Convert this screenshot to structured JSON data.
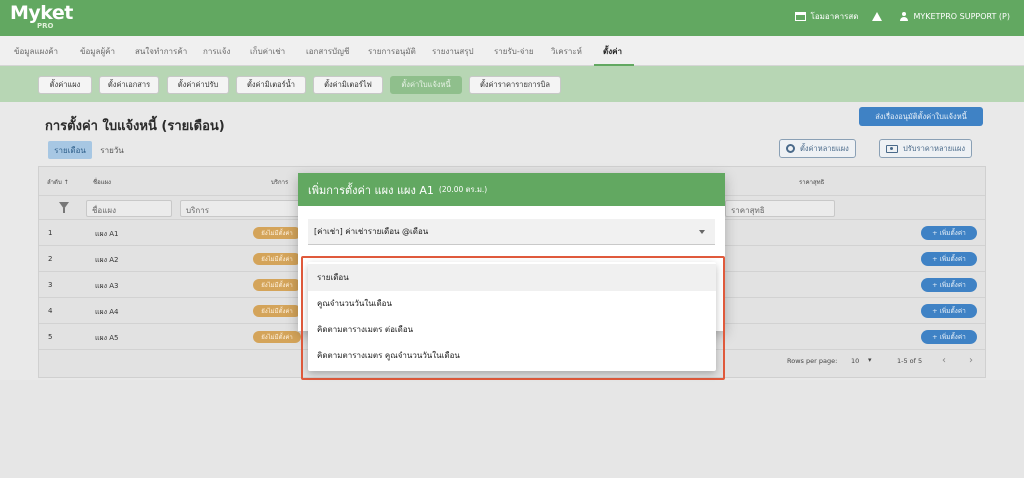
{
  "app": {
    "logo": "Myket",
    "logo_sub": "PRO",
    "shop_name": "โอมอาคารสด",
    "user": "MYKETPRO SUPPORT (P)"
  },
  "main_nav": [
    "ข้อมูลแผงค้า",
    "ข้อมูลผู้ค้า",
    "สนใจทำการค้า",
    "การแจ้ง",
    "เก็บค่าเช่า",
    "เอกสารบัญชี",
    "รายการอนุมัติ",
    "รายงานสรุป",
    "รายรับ-จ่าย",
    "วิเคราะห์",
    "ตั้งค่า"
  ],
  "sub_nav": [
    "ตั้งค่าแผง",
    "ตั้งค่าเอกสาร",
    "ตั้งค่าค่าปรับ",
    "ตั้งค่ามิเตอร์น้ำ",
    "ตั้งค่ามิเตอร์ไฟ",
    "ตั้งค่าใบแจ้งหนี้",
    "ตั้งค่าราคารายการบิล"
  ],
  "page": {
    "title": "การตั้งค่า ใบแจ้งหนี้ (รายเดือน)",
    "send_button": "ส่งเรื่องอนุมัติตั้งค่าใบแจ้งหนี้",
    "tab_monthly": "รายเดือน",
    "tab_daily": "รายวัน",
    "bulk_settings_button": "ตั้งค่าหลายแผง",
    "bulk_price_button": "ปรับราคาหลายแผง"
  },
  "table": {
    "headers": {
      "index": "ลำดับ ↑",
      "stall": "ชื่อแผง",
      "service": "บริการ",
      "net": "ราคาสุทธิ"
    },
    "filters": {
      "stall_placeholder": "ชื่อแผง",
      "service_placeholder": "บริการ",
      "net_placeholder": "ราคาสุทธิ"
    },
    "rows": [
      {
        "index": "1",
        "name": "แผง A1",
        "badge": "ยังไม่มีตั้งค่า",
        "add": "+ เพิ่มตั้งค่า"
      },
      {
        "index": "2",
        "name": "แผง A2",
        "badge": "ยังไม่มีตั้งค่า",
        "add": "+ เพิ่มตั้งค่า"
      },
      {
        "index": "3",
        "name": "แผง A3",
        "badge": "ยังไม่มีตั้งค่า",
        "add": "+ เพิ่มตั้งค่า"
      },
      {
        "index": "4",
        "name": "แผง A4",
        "badge": "ยังไม่มีตั้งค่า",
        "add": "+ เพิ่มตั้งค่า"
      },
      {
        "index": "5",
        "name": "แผง A5",
        "badge": "ยังไม่มีตั้งค่า",
        "add": "+ เพิ่มตั้งค่า"
      }
    ],
    "pagination": {
      "rows_per_page_label": "Rows per page:",
      "rows_per_page": "10",
      "range": "1-5 of 5"
    }
  },
  "modal": {
    "title": "เพิ่มการตั้งค่า แผง แผง A1",
    "area": "(20.00 ตร.ม.)",
    "select_value": "[ค่าเช่า] ค่าเช่ารายเดือน @เดือน",
    "options": [
      "รายเดือน",
      "คูณจำนวนวันในเดือน",
      "คิดตามตารางเมตร ต่อเดือน",
      "คิดตามตารางเมตร คูณจำนวนวันในเดือน"
    ]
  },
  "colors": {
    "brand_green": "#62a861",
    "primary_blue": "#3f82c5",
    "badge_orange": "#d4a45a",
    "highlight_red": "#e05a3c"
  }
}
